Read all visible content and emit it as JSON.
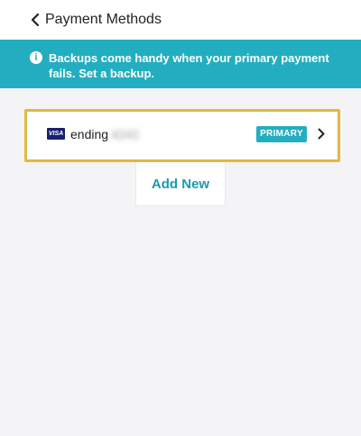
{
  "header": {
    "title": "Payment Methods"
  },
  "banner": {
    "message": "Backups come handy when your primary payment fails. Set a backup."
  },
  "payment_methods": [
    {
      "brand": "VISA",
      "label": "ending",
      "last4": "4242",
      "badge": "PRIMARY"
    }
  ],
  "add_new_label": "Add New",
  "colors": {
    "accent": "#22aec0",
    "highlight": "#e2b83e",
    "visa": "#1a1f71"
  },
  "icons": {
    "back": "chevron-left-icon",
    "info": "info-icon",
    "card": "visa-logo-icon",
    "row": "chevron-right-icon"
  }
}
